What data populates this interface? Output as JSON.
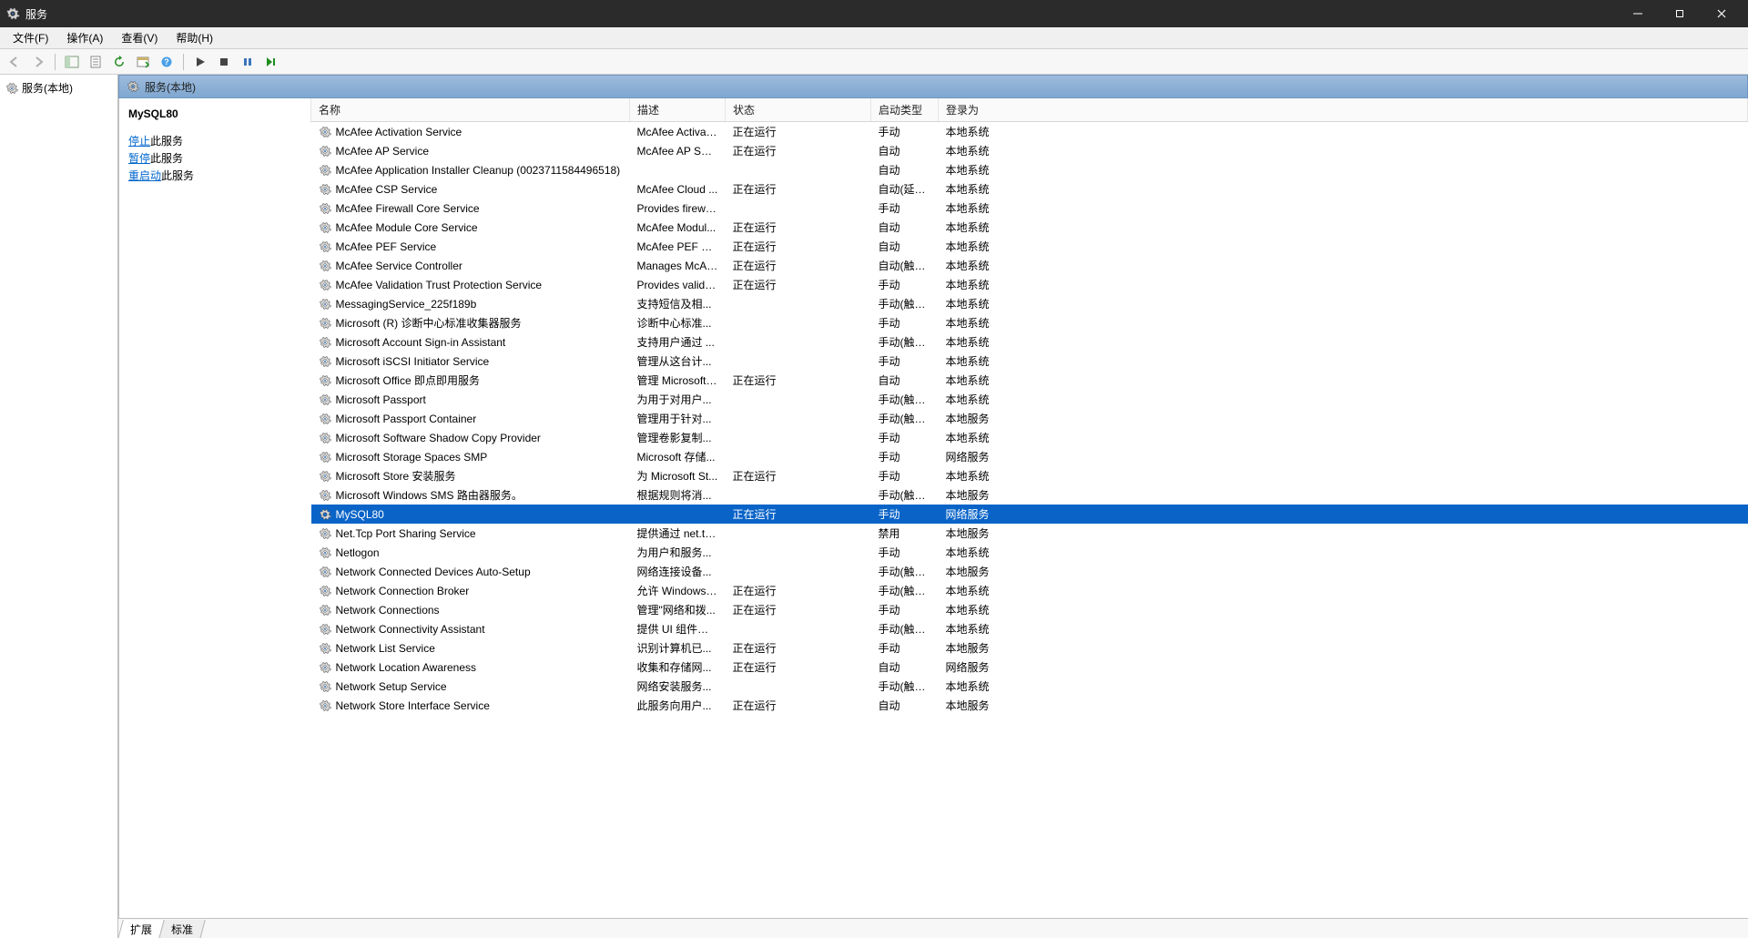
{
  "window": {
    "title": "服务"
  },
  "menubar": [
    "文件(F)",
    "操作(A)",
    "查看(V)",
    "帮助(H)"
  ],
  "tree": {
    "root": "服务(本地)"
  },
  "content_header": "服务(本地)",
  "detail": {
    "selected_name": "MySQL80",
    "actions": [
      {
        "link": "停止",
        "rest": "此服务"
      },
      {
        "link": "暂停",
        "rest": "此服务"
      },
      {
        "link": "重启动",
        "rest": "此服务"
      }
    ]
  },
  "columns": [
    "名称",
    "描述",
    "状态",
    "启动类型",
    "登录为"
  ],
  "tabs": [
    "扩展",
    "标准"
  ],
  "active_tab": 0,
  "selected_index": 20,
  "services": [
    {
      "name": "McAfee Activation Service",
      "desc": "McAfee Activat...",
      "status": "正在运行",
      "startup": "手动",
      "logon": "本地系统"
    },
    {
      "name": "McAfee AP Service",
      "desc": "McAfee AP Ser...",
      "status": "正在运行",
      "startup": "自动",
      "logon": "本地系统"
    },
    {
      "name": "McAfee Application Installer Cleanup (0023711584496518)",
      "desc": "",
      "status": "",
      "startup": "自动",
      "logon": "本地系统"
    },
    {
      "name": "McAfee CSP Service",
      "desc": "McAfee Cloud ...",
      "status": "正在运行",
      "startup": "自动(延迟...",
      "logon": "本地系统"
    },
    {
      "name": "McAfee Firewall Core Service",
      "desc": "Provides firewa...",
      "status": "",
      "startup": "手动",
      "logon": "本地系统"
    },
    {
      "name": "McAfee Module Core Service",
      "desc": "McAfee Modul...",
      "status": "正在运行",
      "startup": "自动",
      "logon": "本地系统"
    },
    {
      "name": "McAfee PEF Service",
      "desc": "McAfee PEF Se...",
      "status": "正在运行",
      "startup": "自动",
      "logon": "本地系统"
    },
    {
      "name": "McAfee Service Controller",
      "desc": "Manages McAf...",
      "status": "正在运行",
      "startup": "自动(触发...",
      "logon": "本地系统"
    },
    {
      "name": "McAfee Validation Trust Protection Service",
      "desc": "Provides valida...",
      "status": "正在运行",
      "startup": "手动",
      "logon": "本地系统"
    },
    {
      "name": "MessagingService_225f189b",
      "desc": "支持短信及相...",
      "status": "",
      "startup": "手动(触发...",
      "logon": "本地系统"
    },
    {
      "name": "Microsoft (R) 诊断中心标准收集器服务",
      "desc": "诊断中心标准...",
      "status": "",
      "startup": "手动",
      "logon": "本地系统"
    },
    {
      "name": "Microsoft Account Sign-in Assistant",
      "desc": "支持用户通过 ...",
      "status": "",
      "startup": "手动(触发...",
      "logon": "本地系统"
    },
    {
      "name": "Microsoft iSCSI Initiator Service",
      "desc": "管理从这台计...",
      "status": "",
      "startup": "手动",
      "logon": "本地系统"
    },
    {
      "name": "Microsoft Office 即点即用服务",
      "desc": "管理 Microsoft ...",
      "status": "正在运行",
      "startup": "自动",
      "logon": "本地系统"
    },
    {
      "name": "Microsoft Passport",
      "desc": "为用于对用户...",
      "status": "",
      "startup": "手动(触发...",
      "logon": "本地系统"
    },
    {
      "name": "Microsoft Passport Container",
      "desc": "管理用于针对...",
      "status": "",
      "startup": "手动(触发...",
      "logon": "本地服务"
    },
    {
      "name": "Microsoft Software Shadow Copy Provider",
      "desc": "管理卷影复制...",
      "status": "",
      "startup": "手动",
      "logon": "本地系统"
    },
    {
      "name": "Microsoft Storage Spaces SMP",
      "desc": "Microsoft 存储...",
      "status": "",
      "startup": "手动",
      "logon": "网络服务"
    },
    {
      "name": "Microsoft Store 安装服务",
      "desc": "为 Microsoft St...",
      "status": "正在运行",
      "startup": "手动",
      "logon": "本地系统"
    },
    {
      "name": "Microsoft Windows SMS 路由器服务。",
      "desc": "根据规则将消...",
      "status": "",
      "startup": "手动(触发...",
      "logon": "本地服务"
    },
    {
      "name": "MySQL80",
      "desc": "",
      "status": "正在运行",
      "startup": "手动",
      "logon": "网络服务"
    },
    {
      "name": "Net.Tcp Port Sharing Service",
      "desc": "提供通过 net.tc...",
      "status": "",
      "startup": "禁用",
      "logon": "本地服务"
    },
    {
      "name": "Netlogon",
      "desc": "为用户和服务...",
      "status": "",
      "startup": "手动",
      "logon": "本地系统"
    },
    {
      "name": "Network Connected Devices Auto-Setup",
      "desc": "网络连接设备...",
      "status": "",
      "startup": "手动(触发...",
      "logon": "本地服务"
    },
    {
      "name": "Network Connection Broker",
      "desc": "允许 Windows ...",
      "status": "正在运行",
      "startup": "手动(触发...",
      "logon": "本地系统"
    },
    {
      "name": "Network Connections",
      "desc": "管理\"网络和拨...",
      "status": "正在运行",
      "startup": "手动",
      "logon": "本地系统"
    },
    {
      "name": "Network Connectivity Assistant",
      "desc": "提供 UI 组件的 ...",
      "status": "",
      "startup": "手动(触发...",
      "logon": "本地系统"
    },
    {
      "name": "Network List Service",
      "desc": "识别计算机已...",
      "status": "正在运行",
      "startup": "手动",
      "logon": "本地服务"
    },
    {
      "name": "Network Location Awareness",
      "desc": "收集和存储网...",
      "status": "正在运行",
      "startup": "自动",
      "logon": "网络服务"
    },
    {
      "name": "Network Setup Service",
      "desc": "网络安装服务...",
      "status": "",
      "startup": "手动(触发...",
      "logon": "本地系统"
    },
    {
      "name": "Network Store Interface Service",
      "desc": "此服务向用户...",
      "status": "正在运行",
      "startup": "自动",
      "logon": "本地服务"
    }
  ]
}
